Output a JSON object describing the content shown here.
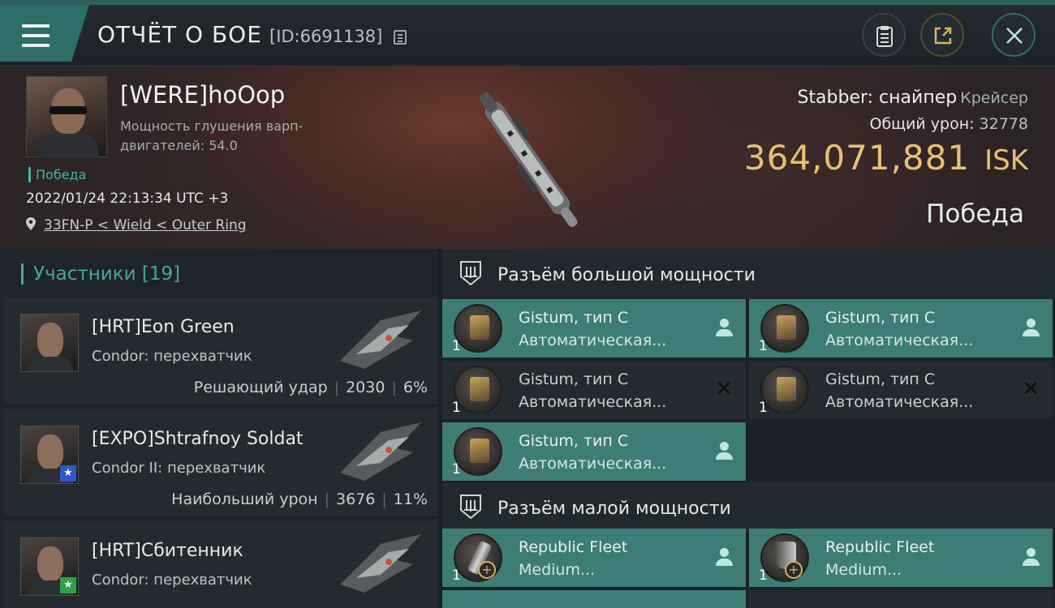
{
  "header": {
    "title": "ОТЧЁТ О БОЕ",
    "report_id": "[ID:6691138]",
    "icons": [
      "menu-icon",
      "copy-icon",
      "clipboard-icon",
      "share-icon",
      "close-icon"
    ]
  },
  "summary": {
    "pilot_name": "[WERE]hoOop",
    "stat_label": "Мощность глушения варп-двигателей: 54.0",
    "result": "Победа",
    "datetime": "2022/01/24 22:13:34 UTC +3",
    "location": "33FN-P < Wield < Outer Ring",
    "ship_name": "Stabber: снайпер",
    "ship_class": "Крейсер",
    "damage_label": "Общий урон:",
    "damage_value": "32778",
    "isk_value": "364,071,881",
    "isk_unit": "ISK",
    "outcome": "Победа"
  },
  "participants": {
    "heading": "Участники [19]",
    "items": [
      {
        "name": "[HRT]Eon Green",
        "ship": "Condor: перехватчик",
        "stat_label": "Решающий удар",
        "damage": "2030",
        "percent": "6%"
      },
      {
        "name": "[EXPO]Shtrafnoy Soldat",
        "ship": "Condor II: перехватчик",
        "stat_label": "Наибольший урон",
        "damage": "3676",
        "percent": "11%"
      },
      {
        "name": "[HRT]Сбитенник",
        "ship": "Condor: перехватчик",
        "stat_label": "",
        "damage": "",
        "percent": ""
      }
    ]
  },
  "high_slots": {
    "title": "Разъём большой мощности",
    "items": [
      {
        "name": "Gistum, тип C",
        "type": "Автоматическая...",
        "qty": "1",
        "state": "fitted"
      },
      {
        "name": "Gistum, тип C",
        "type": "Автоматическая...",
        "qty": "1",
        "state": "fitted"
      },
      {
        "name": "Gistum, тип C",
        "type": "Автоматическая...",
        "qty": "1",
        "state": "destroyed"
      },
      {
        "name": "Gistum, тип C",
        "type": "Автоматическая...",
        "qty": "1",
        "state": "destroyed"
      },
      {
        "name": "Gistum, тип C",
        "type": "Автоматическая...",
        "qty": "1",
        "state": "fitted"
      }
    ]
  },
  "low_slots": {
    "title": "Разъём малой мощности",
    "items": [
      {
        "name": "Republic Fleet",
        "type": "Medium...",
        "qty": "1",
        "state": "fitted"
      },
      {
        "name": "Republic Fleet",
        "type": "Medium...",
        "qty": "1",
        "state": "fitted"
      }
    ]
  },
  "colors": {
    "accent": "#43a89c",
    "fitted_slot": "#3e7d76",
    "isk": "#e7c173"
  }
}
